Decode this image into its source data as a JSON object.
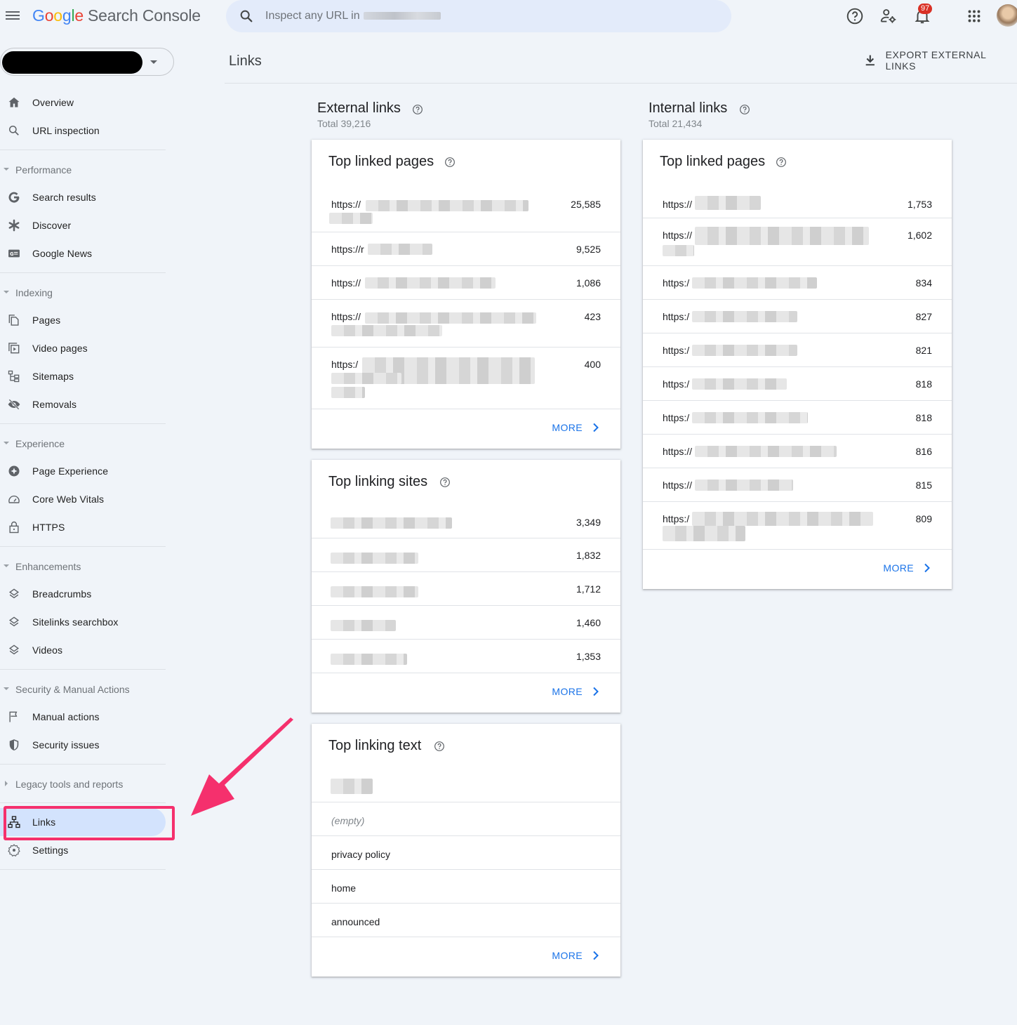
{
  "header": {
    "app_name_brand": [
      "G",
      "o",
      "o",
      "g",
      "l",
      "e"
    ],
    "app_name_product": "Search Console",
    "search_placeholder": "Inspect any URL in",
    "notification_count": "97",
    "icons": [
      "menu-icon",
      "search-icon",
      "help-icon",
      "manage-users-icon",
      "notifications-icon",
      "apps-grid-icon",
      "account-avatar"
    ]
  },
  "property_selector": {
    "value": "[redacted]"
  },
  "sidebar": {
    "top_items": [
      {
        "label": "Overview",
        "icon": "home-icon"
      },
      {
        "label": "URL inspection",
        "icon": "search-icon"
      }
    ],
    "sections": [
      {
        "label": "Performance",
        "expanded": true,
        "items": [
          {
            "label": "Search results",
            "icon": "google-g-icon"
          },
          {
            "label": "Discover",
            "icon": "asterisk-icon"
          },
          {
            "label": "Google News",
            "icon": "google-news-icon"
          }
        ]
      },
      {
        "label": "Indexing",
        "expanded": true,
        "items": [
          {
            "label": "Pages",
            "icon": "pages-icon"
          },
          {
            "label": "Video pages",
            "icon": "video-pages-icon"
          },
          {
            "label": "Sitemaps",
            "icon": "sitemap-icon"
          },
          {
            "label": "Removals",
            "icon": "eye-off-icon"
          }
        ]
      },
      {
        "label": "Experience",
        "expanded": true,
        "items": [
          {
            "label": "Page Experience",
            "icon": "page-experience-icon"
          },
          {
            "label": "Core Web Vitals",
            "icon": "gauge-icon"
          },
          {
            "label": "HTTPS",
            "icon": "lock-icon"
          }
        ]
      },
      {
        "label": "Enhancements",
        "expanded": true,
        "items": [
          {
            "label": "Breadcrumbs",
            "icon": "layers-icon"
          },
          {
            "label": "Sitelinks searchbox",
            "icon": "layers-icon"
          },
          {
            "label": "Videos",
            "icon": "layers-icon"
          }
        ]
      },
      {
        "label": "Security & Manual Actions",
        "expanded": true,
        "items": [
          {
            "label": "Manual actions",
            "icon": "flag-icon"
          },
          {
            "label": "Security issues",
            "icon": "shield-icon"
          }
        ]
      },
      {
        "label": "Legacy tools and reports",
        "expanded": false,
        "items": []
      }
    ],
    "bottom_items": [
      {
        "label": "Links",
        "icon": "links-icon",
        "active": true
      },
      {
        "label": "Settings",
        "icon": "gear-icon"
      }
    ]
  },
  "main": {
    "page_title": "Links",
    "export_label": "EXPORT EXTERNAL LINKS",
    "external": {
      "title": "External links",
      "total": "Total 39,216",
      "top_linked_pages": {
        "title": "Top linked pages",
        "rows": [
          {
            "url": "https://",
            "value": "25,585"
          },
          {
            "url": "https://r",
            "value": "9,525"
          },
          {
            "url": "https://",
            "value": "1,086"
          },
          {
            "url": "https://",
            "value": "423"
          },
          {
            "url": "https:/",
            "value": "400"
          }
        ],
        "more": "MORE"
      },
      "top_linking_sites": {
        "title": "Top linking sites",
        "rows": [
          {
            "site": "",
            "value": "3,349"
          },
          {
            "site": "",
            "value": "1,832"
          },
          {
            "site": "",
            "value": "1,712"
          },
          {
            "site": "",
            "value": "1,460"
          },
          {
            "site": "",
            "value": "1,353"
          }
        ],
        "more": "MORE"
      },
      "top_linking_text": {
        "title": "Top linking text",
        "rows": [
          {
            "text": ""
          },
          {
            "text": "(empty)"
          },
          {
            "text": "privacy policy"
          },
          {
            "text": "home"
          },
          {
            "text": "announced"
          }
        ],
        "more": "MORE"
      }
    },
    "internal": {
      "title": "Internal links",
      "total": "Total 21,434",
      "top_linked_pages": {
        "title": "Top linked pages",
        "rows": [
          {
            "url": "https://",
            "value": "1,753"
          },
          {
            "url": "https://",
            "value": "1,602"
          },
          {
            "url": "https:/",
            "value": "834"
          },
          {
            "url": "https:/",
            "value": "827"
          },
          {
            "url": "https:/",
            "value": "821"
          },
          {
            "url": "https:/",
            "value": "818"
          },
          {
            "url": "https:/",
            "value": "818"
          },
          {
            "url": "https://",
            "value": "816"
          },
          {
            "url": "https://",
            "value": "815"
          },
          {
            "url": "https:/",
            "value": "809"
          }
        ],
        "more": "MORE"
      }
    }
  },
  "colors": {
    "background": "#f0f4f9",
    "accent_blue": "#1a73e8",
    "active_nav": "#d3e3fd",
    "annotation_pink": "#f5306d",
    "badge_red": "#d93025"
  }
}
